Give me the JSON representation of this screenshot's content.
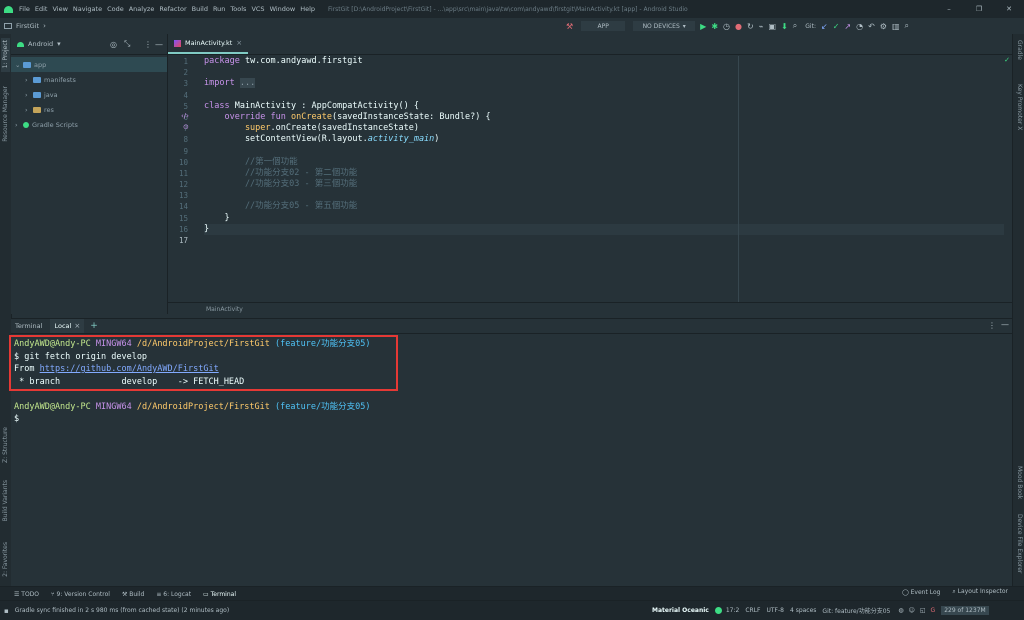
{
  "title_bar": {
    "menus": [
      "File",
      "Edit",
      "View",
      "Navigate",
      "Code",
      "Analyze",
      "Refactor",
      "Build",
      "Run",
      "Tools",
      "VCS",
      "Window",
      "Help"
    ],
    "window_title": "FirstGit [D:\\AndroidProject\\FirstGit] - ...\\app\\src\\main\\java\\tw\\com\\andyawd\\firstgit\\MainActivity.kt [app] - Android Studio",
    "minimize": "–",
    "restore": "❐",
    "close": "✕"
  },
  "nav_bar": {
    "breadcrumb": "FirstGit",
    "chevron": "›",
    "run_config": "APP",
    "device": "NO DEVICES",
    "git_label": "Git:"
  },
  "project_panel": {
    "view_mode": "Android",
    "tree": [
      {
        "label": "app",
        "level": 0,
        "expanded": true,
        "selected": true
      },
      {
        "label": "manifests",
        "level": 1
      },
      {
        "label": "java",
        "level": 1
      },
      {
        "label": "res",
        "level": 1
      },
      {
        "label": "Gradle Scripts",
        "level": 0
      }
    ]
  },
  "left_strip": {
    "project": "1: Project",
    "resource_manager": "Resource Manager",
    "structure": "Z: Structure",
    "build_variants": "Build Variants",
    "favorites": "2: Favorites"
  },
  "right_strip": {
    "gradle": "Gradle",
    "key_promoter": "Key Promoter X",
    "mood_book": "Mood Book",
    "device_file_explorer": "Device File Explorer"
  },
  "editor": {
    "tab_label": "MainActivity.kt",
    "tab_close": "×",
    "breadcrumb": "MainActivity",
    "line_numbers": [
      "1",
      "2",
      "3",
      "4",
      "5",
      "6",
      "7",
      "8",
      "9",
      "10",
      "11",
      "12",
      "13",
      "14",
      "15",
      "16",
      "17"
    ],
    "lines": {
      "l1_kw": "package",
      "l1_txt": " tw.com.andyawd.firstgit",
      "l3_kw": "import",
      "l3_fold": "...",
      "l6_kw": "class",
      "l6_txt": " MainActivity : AppCompatActivity() {",
      "l7_kw": "    override fun ",
      "l7_fn": "onCreate",
      "l7_txt": "(savedInstanceState: Bundle?) {",
      "l8_kw": "        super",
      "l8_txt": ".onCreate(savedInstanceState)",
      "l9_txt": "        setContentView(R.layout.",
      "l9_ital": "activity_main",
      "l9_end": ")",
      "l11": "        //第一個功能",
      "l12": "        //功能分支02 - 第二個功能",
      "l13": "        //功能分支03 - 第三個功能",
      "l15": "        //功能分支05 - 第五個功能",
      "l16": "    }",
      "l17": "}"
    }
  },
  "terminal": {
    "title": "Terminal",
    "tab": "Local",
    "tab_close": "×",
    "add": "+",
    "prompt_user": "AndyAWD@Andy-PC",
    "prompt_env": "MINGW64",
    "prompt_path": "/d/AndroidProject/FirstGit",
    "prompt_branch": "(feature/功能分支05)",
    "command": "$ git fetch origin develop",
    "from_label": "From ",
    "from_url": "https://github.com/AndyAWD/FirstGit",
    "branch_line": " * branch            develop    -> FETCH_HEAD",
    "dollar": "$",
    "highlight_color": "#e53935"
  },
  "bottom_tabs": {
    "todo": "TODO",
    "version_control": "9: Version Control",
    "build": "Build",
    "logcat": "6: Logcat",
    "terminal": "Terminal",
    "event_log": "Event Log",
    "layout_inspector": "Layout Inspector"
  },
  "status_bar": {
    "message": "Gradle sync finished in 2 s 980 ms (from cached state) (2 minutes ago)",
    "theme": "Material Oceanic",
    "position": "17:2",
    "line_sep": "CRLF",
    "encoding": "UTF-8",
    "indent": "4 spaces",
    "git_branch": "Git: feature/功能分支05",
    "memory": "229 of 1237M"
  }
}
